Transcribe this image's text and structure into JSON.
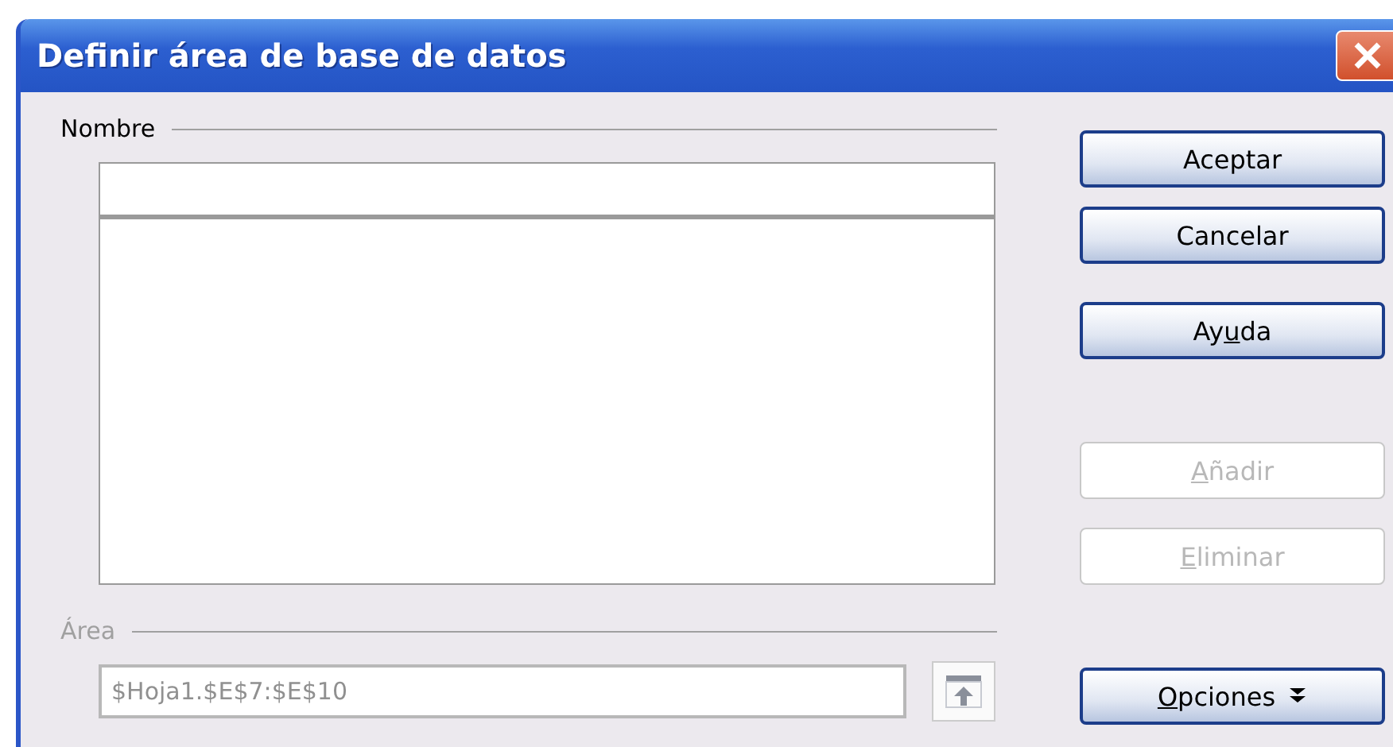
{
  "window": {
    "title": "Definir área de base de datos"
  },
  "name_section": {
    "label": "Nombre"
  },
  "area_section": {
    "label": "Área",
    "disabled": true,
    "value": "$Hoja1.$E$7:$E$10"
  },
  "buttons": [
    {
      "label": {
        "pre": "Aceptar"
      },
      "disabled": false,
      "kind": "plain"
    },
    {
      "label": {
        "pre": "Cancelar"
      },
      "disabled": false,
      "kind": "plain"
    },
    {
      "label": {
        "pre": "Ay",
        "key": "u",
        "post": "da"
      },
      "disabled": false,
      "kind": "plain"
    },
    {
      "label": {
        "key": "A",
        "post": "ñadir"
      },
      "disabled": true,
      "kind": "plain"
    },
    {
      "label": {
        "key": "E",
        "post": "liminar"
      },
      "disabled": true,
      "kind": "plain"
    },
    {
      "label": {
        "key": "O",
        "post": "pciones"
      },
      "disabled": false,
      "kind": "more"
    }
  ]
}
